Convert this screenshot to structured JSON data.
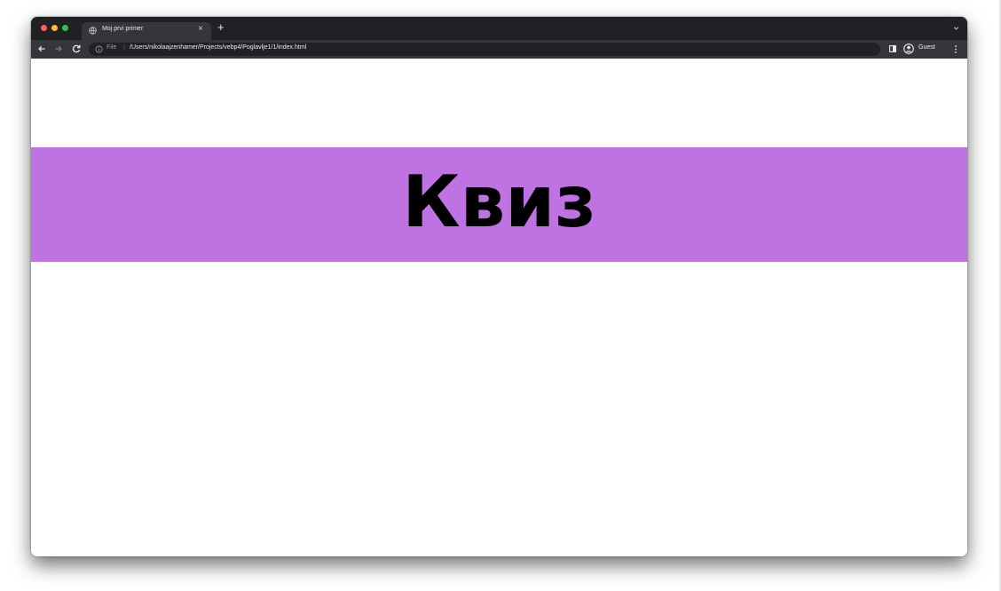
{
  "colors": {
    "close": "#ff5f57",
    "minimize": "#febc2e",
    "zoom": "#28c840",
    "chrome_dark": "#202124",
    "chrome_toolbar": "#35363a",
    "banner": "#bf73e2"
  },
  "browser": {
    "tab": {
      "title": "Moj prvi primer",
      "favicon": "globe-icon",
      "close_glyph": "×"
    },
    "new_tab_glyph": "+",
    "address_bar": {
      "scheme_label": "File",
      "separator": "|",
      "url": "/Users/nikolaajzenhamer/Projects/vebp4/Poglavlje1/1/index.html",
      "info_icon": "info-icon"
    },
    "profile_label": "Guest"
  },
  "page": {
    "heading": "Квиз"
  }
}
